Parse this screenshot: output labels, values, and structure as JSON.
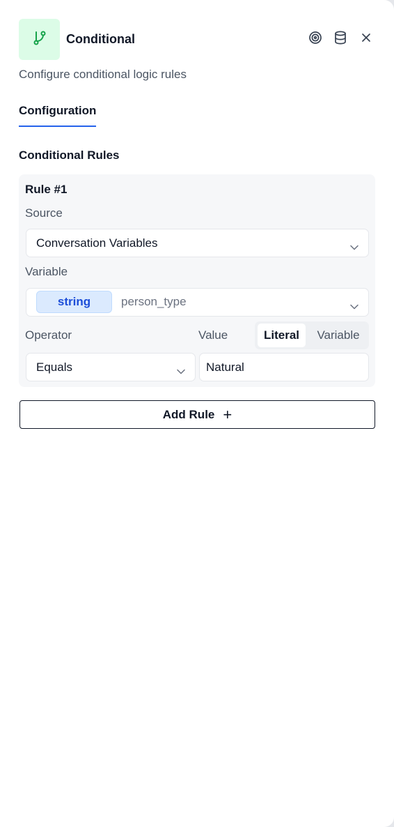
{
  "header": {
    "title": "Conditional",
    "subtitle": "Configure conditional logic rules",
    "node_icon": "git-branch-icon",
    "actions": [
      "target-icon",
      "database-icon",
      "close-icon"
    ]
  },
  "tabs": [
    {
      "label": "Configuration",
      "active": true
    }
  ],
  "section": {
    "title": "Conditional Rules"
  },
  "rules": [
    {
      "title": "Rule #1",
      "source_label": "Source",
      "source_value": "Conversation Variables",
      "variable_label": "Variable",
      "variable_type": "string",
      "variable_name": "person_type",
      "operator_label": "Operator",
      "operator_value": "Equals",
      "value_label": "Value",
      "value_modes": [
        "Literal",
        "Variable"
      ],
      "value_mode_selected": "Literal",
      "value": "Natural"
    }
  ],
  "add_rule": {
    "label": "Add Rule"
  },
  "colors": {
    "accent": "#2563eb",
    "node_icon_bg": "#dcfce7",
    "node_icon_fg": "#16a34a",
    "badge_bg": "#dbeafe",
    "badge_text": "#1d4ed8"
  }
}
